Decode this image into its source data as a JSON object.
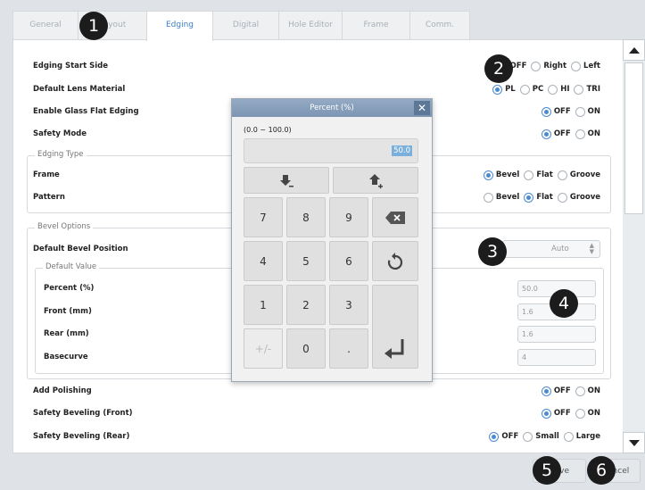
{
  "tabs": [
    {
      "label": "General",
      "active": false
    },
    {
      "label": "Layout",
      "active": false
    },
    {
      "label": "Edging",
      "active": true
    },
    {
      "label": "Digital Pattern",
      "active": false
    },
    {
      "label": "Hole Editor",
      "active": false
    },
    {
      "label": "Frame Fitting",
      "active": false
    },
    {
      "label": "Comm. Port",
      "active": false
    }
  ],
  "settings": {
    "edging_start_side": {
      "label": "Edging Start Side",
      "options": [
        "OFF",
        "Right",
        "Left"
      ],
      "selected": "OFF"
    },
    "default_lens_material": {
      "label": "Default Lens Material",
      "options": [
        "PL",
        "PC",
        "HI",
        "TRI"
      ],
      "selected": "PL"
    },
    "glass_flat_edging": {
      "label": "Enable Glass Flat Edging",
      "options": [
        "OFF",
        "ON"
      ],
      "selected": "OFF"
    },
    "safety_mode": {
      "label": "Safety Mode",
      "options": [
        "OFF",
        "ON"
      ],
      "selected": "OFF"
    },
    "edging_type": {
      "title": "Edging Type",
      "frame": {
        "label": "Frame",
        "options": [
          "Bevel",
          "Flat",
          "Groove"
        ],
        "selected": "Bevel"
      },
      "pattern": {
        "label": "Pattern",
        "options": [
          "Bevel",
          "Flat",
          "Groove"
        ],
        "selected": "Flat"
      }
    },
    "bevel_options": {
      "title": "Bevel Options",
      "default_bevel_position": {
        "label": "Default Bevel Position",
        "value": "Auto"
      },
      "default_value": {
        "title": "Default Value",
        "percent": {
          "label": "Percent (%)",
          "value": "50.0"
        },
        "front": {
          "label": "Front (mm)",
          "value": "1.6"
        },
        "rear": {
          "label": "Rear (mm)",
          "value": "1.6"
        },
        "basecurve": {
          "label": "Basecurve",
          "value": "4"
        }
      }
    },
    "add_polishing": {
      "label": "Add Polishing",
      "options": [
        "OFF",
        "ON"
      ],
      "selected": "OFF"
    },
    "safety_beveling_front": {
      "label": "Safety Beveling (Front)",
      "options": [
        "OFF",
        "ON"
      ],
      "selected": "OFF"
    },
    "safety_beveling_rear": {
      "label": "Safety Beveling (Rear)",
      "options": [
        "OFF",
        "Small",
        "Large"
      ],
      "selected": "OFF"
    }
  },
  "dialog": {
    "title": "Percent (%)",
    "close": "✕",
    "range": "(0.0 ~ 100.0)",
    "value": "50.0",
    "keys": [
      "7",
      "8",
      "9",
      "4",
      "5",
      "6",
      "1",
      "2",
      "3",
      "+/-",
      "0",
      "."
    ]
  },
  "footer": {
    "save": "Save",
    "cancel": "Cancel"
  },
  "markers": [
    "1",
    "2",
    "3",
    "4",
    "5",
    "6"
  ],
  "colors": {
    "accent": "#4a8bd0",
    "tab_active": "#3d7fc4",
    "dialog_title": "#8aa1bd",
    "marker": "#1c1c1c"
  }
}
